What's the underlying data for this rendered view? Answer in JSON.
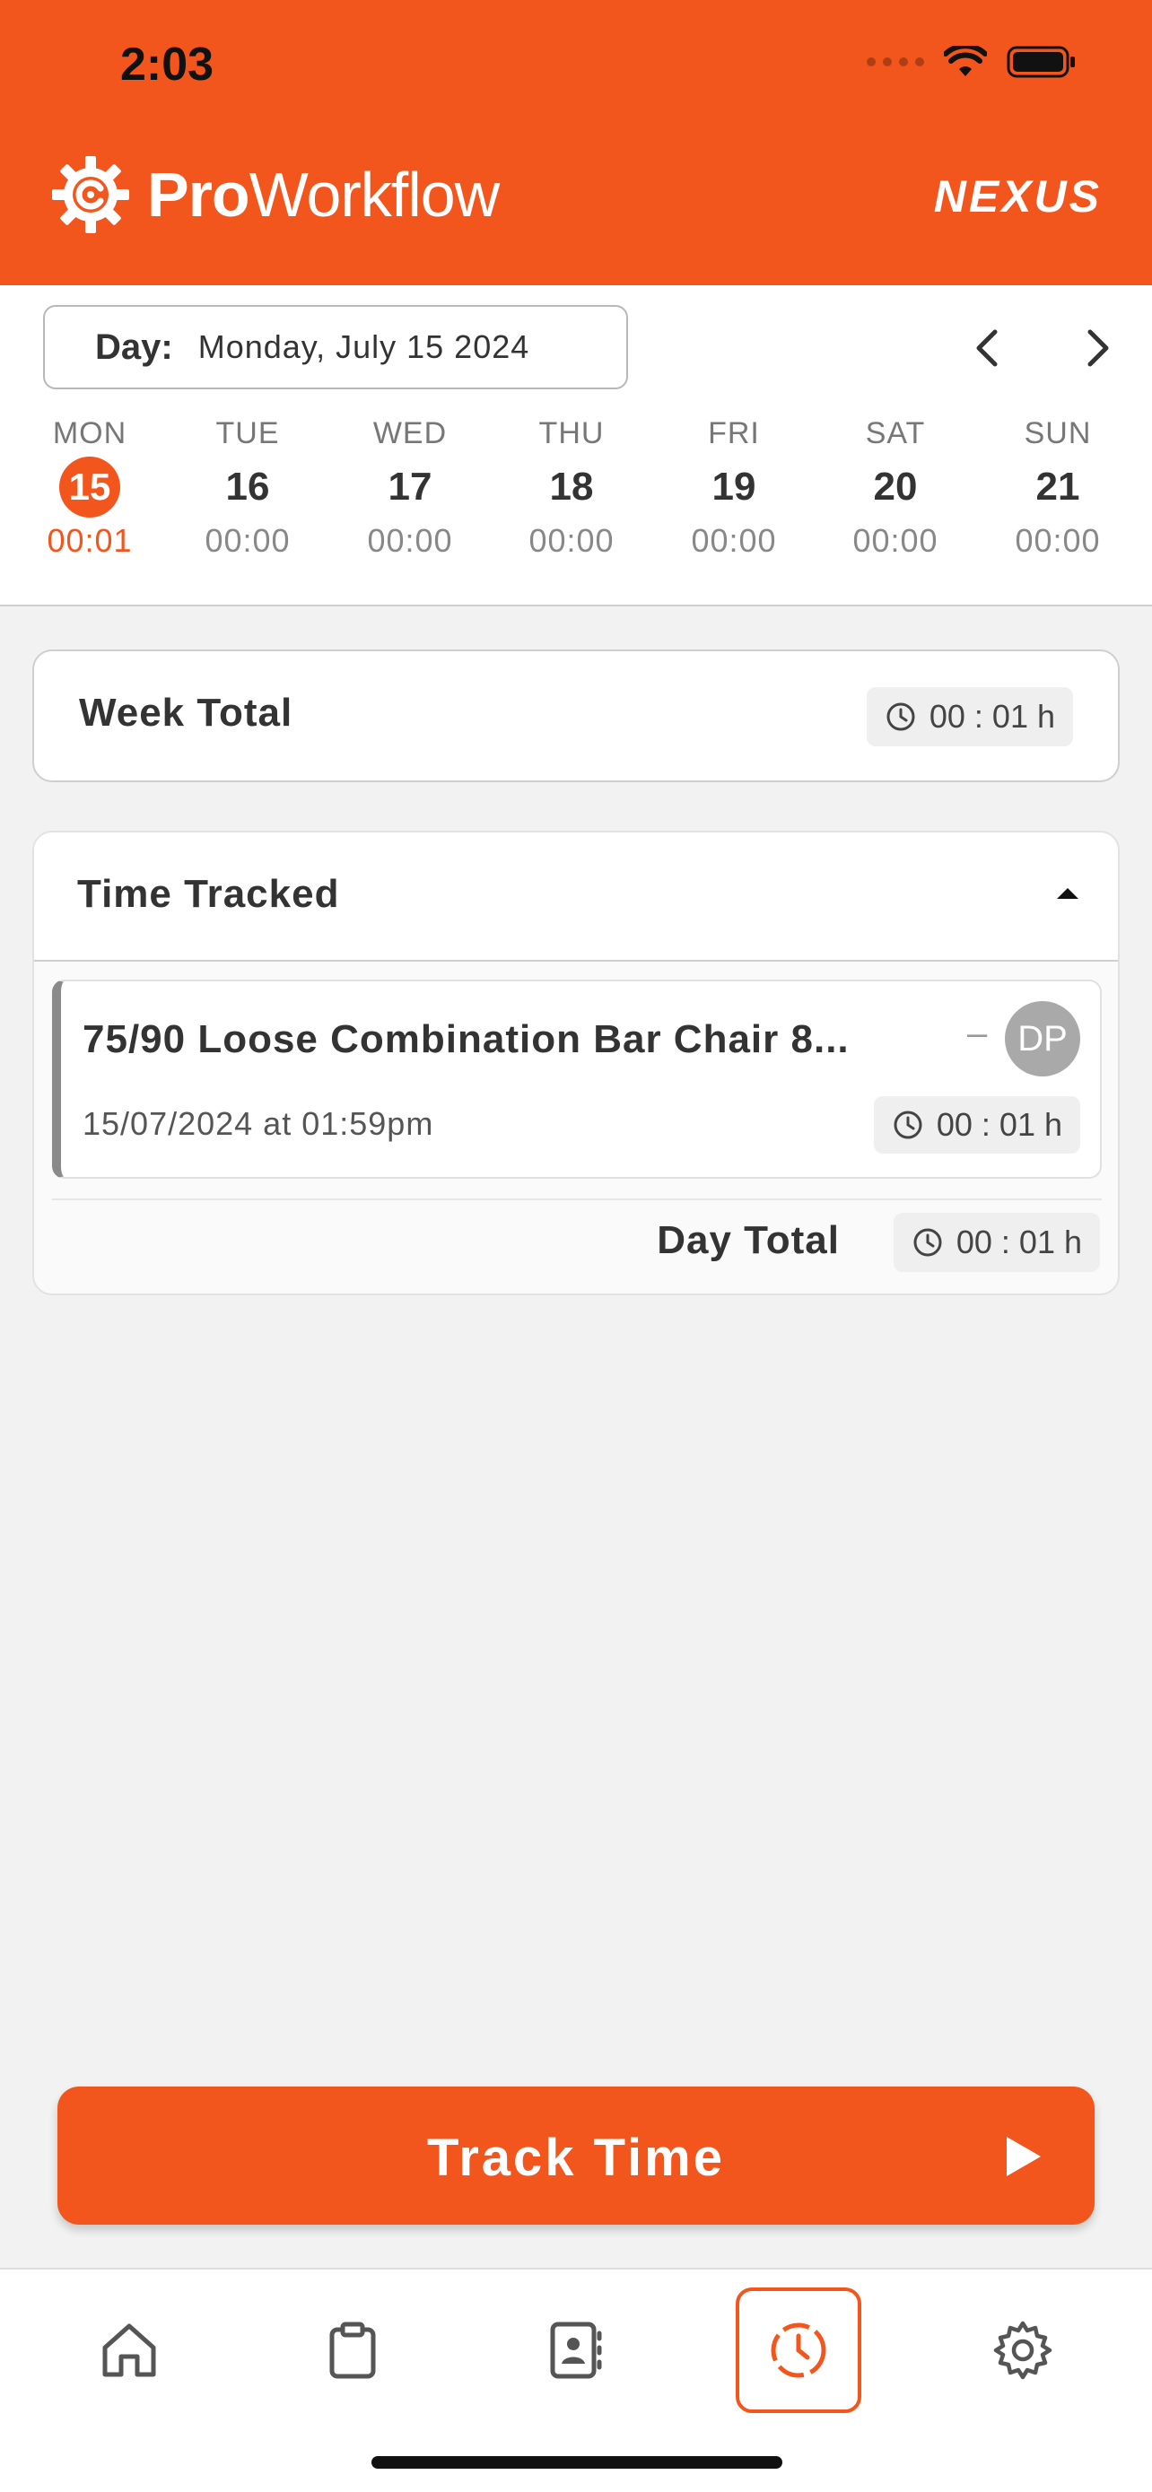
{
  "status_bar": {
    "time": "2:03"
  },
  "header": {
    "logo_bold": "Pro",
    "logo_regular": "Workflow",
    "brand_right": "NEXUS",
    "accent_color": "#f2561d"
  },
  "date_selector": {
    "day_label": "Day:",
    "day_value": "Monday, July 15 2024",
    "prev_icon": "chevron-left-icon",
    "next_icon": "chevron-right-icon"
  },
  "week": [
    {
      "name": "MON",
      "num": "15",
      "time": "00:01",
      "active": true
    },
    {
      "name": "TUE",
      "num": "16",
      "time": "00:00",
      "active": false
    },
    {
      "name": "WED",
      "num": "17",
      "time": "00:00",
      "active": false
    },
    {
      "name": "THU",
      "num": "18",
      "time": "00:00",
      "active": false
    },
    {
      "name": "FRI",
      "num": "19",
      "time": "00:00",
      "active": false
    },
    {
      "name": "SAT",
      "num": "20",
      "time": "00:00",
      "active": false
    },
    {
      "name": "SUN",
      "num": "21",
      "time": "00:00",
      "active": false
    }
  ],
  "week_total": {
    "label": "Week Total",
    "value": "00 : 01 h"
  },
  "time_tracked": {
    "label": "Time Tracked",
    "entries": [
      {
        "title": "75/90 Loose Combination Bar Chair 8...",
        "dash": "–",
        "avatar": "DP",
        "date": "15/07/2024 at 01:59pm",
        "duration": "00 : 01 h"
      }
    ],
    "day_total_label": "Day Total",
    "day_total_value": "00 : 01 h"
  },
  "track_button": {
    "label": "Track Time"
  },
  "bottom_nav": [
    {
      "icon": "home-icon",
      "active": false
    },
    {
      "icon": "clipboard-icon",
      "active": false
    },
    {
      "icon": "contacts-icon",
      "active": false
    },
    {
      "icon": "time-tracking-icon",
      "active": true
    },
    {
      "icon": "gear-icon",
      "active": false
    }
  ]
}
